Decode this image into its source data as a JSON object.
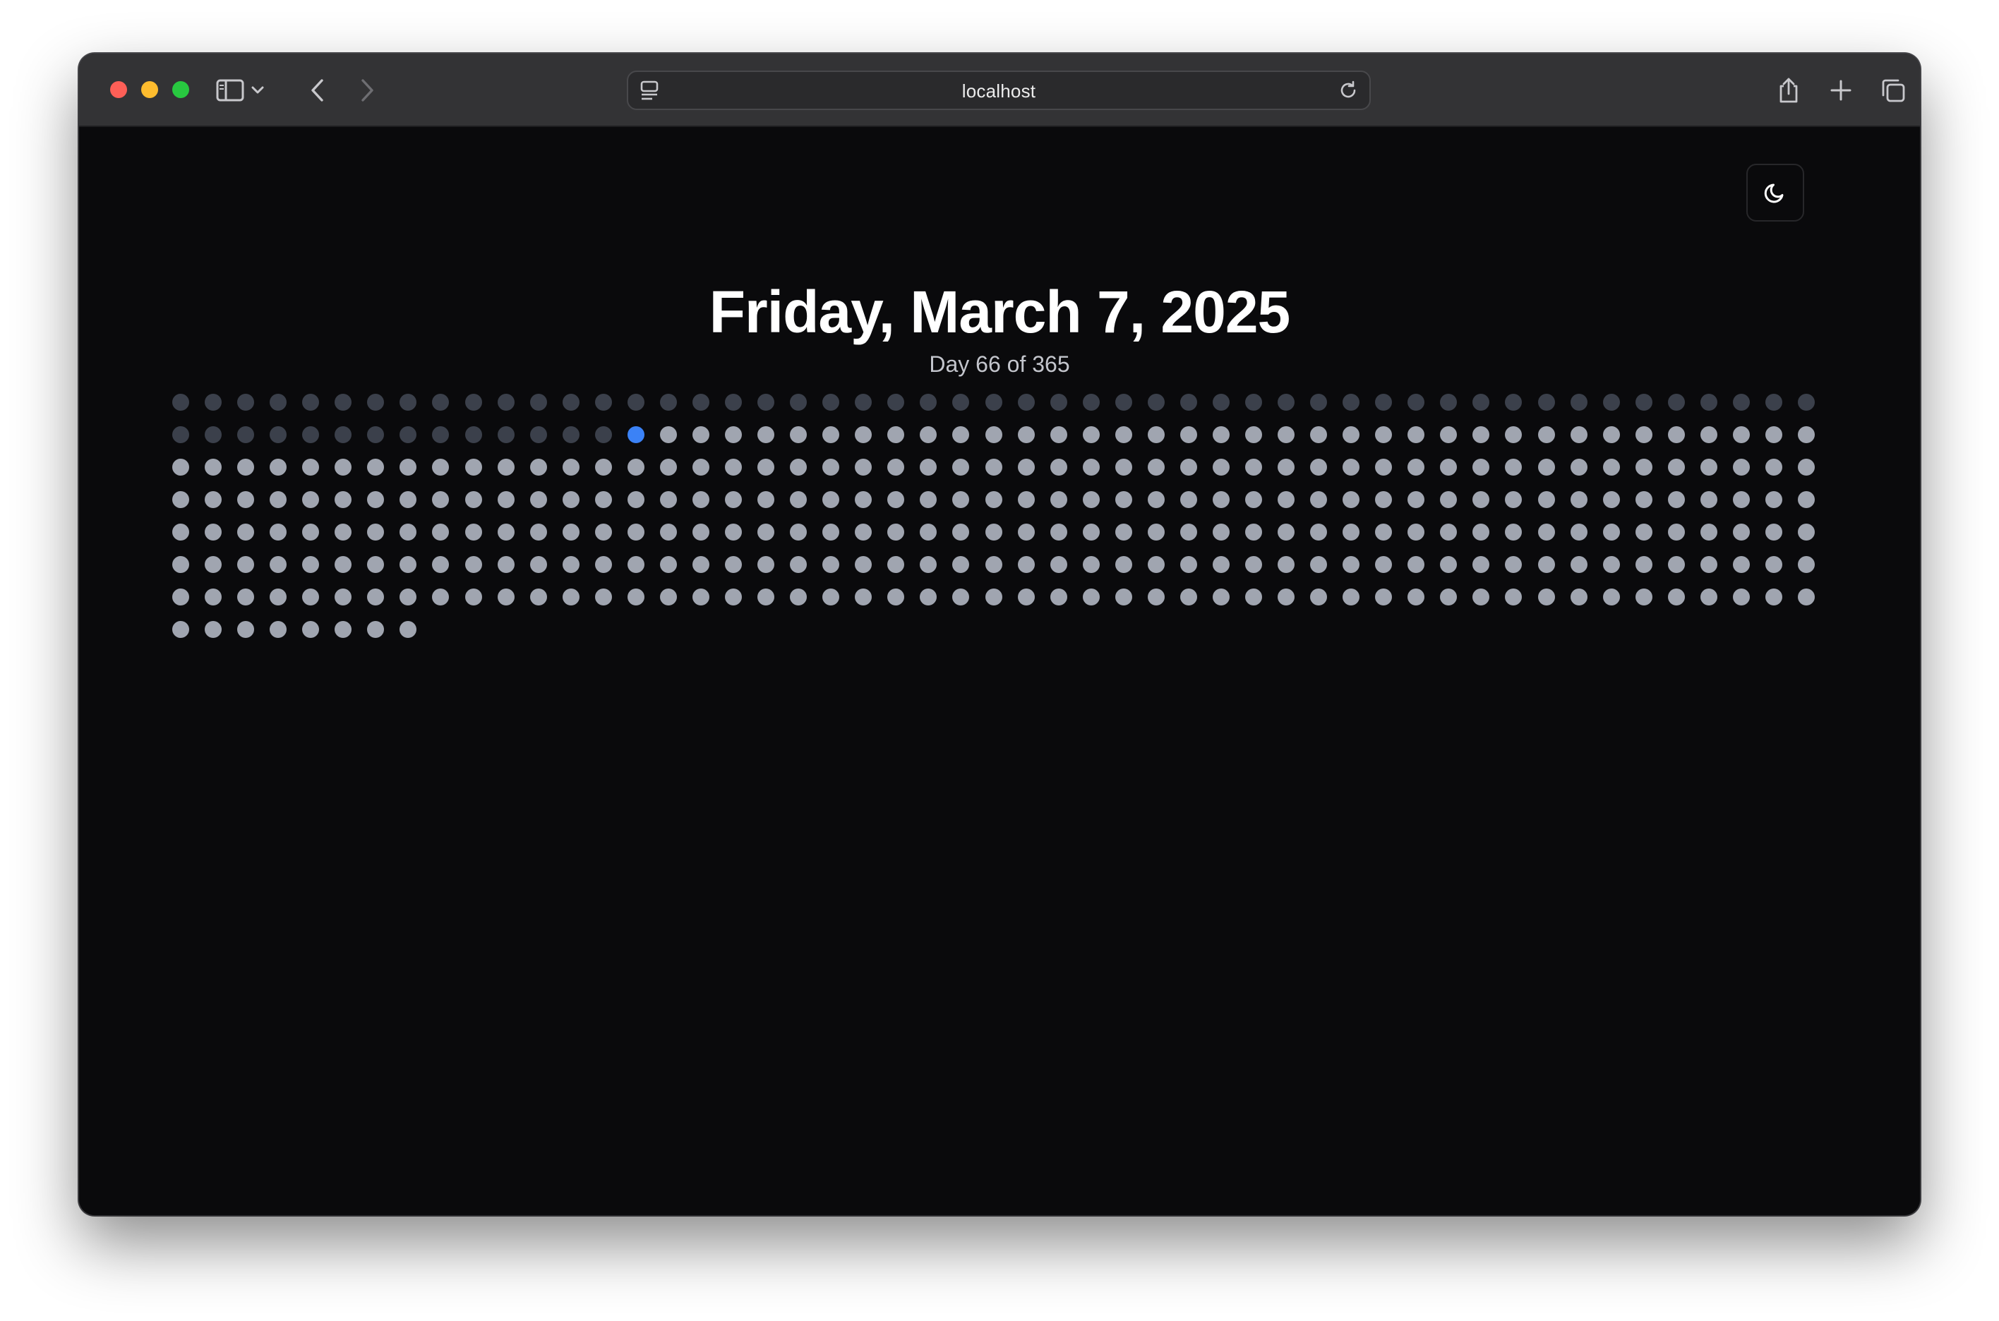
{
  "browser": {
    "url": "localhost",
    "colors": {
      "close": "#fe5f57",
      "minimize": "#febc2e",
      "maximize": "#28c840"
    }
  },
  "page": {
    "title": "Friday, March 7, 2025",
    "subtitle": "Day 66 of 365",
    "theme_toggle_icon": "moon-icon"
  },
  "year_grid": {
    "total_days": 365,
    "current_day": 66,
    "columns": 51,
    "colors": {
      "past": "#3b404b",
      "today": "#3b82f6",
      "future": "#a0a5b0",
      "background": "#0a0a0c"
    }
  }
}
